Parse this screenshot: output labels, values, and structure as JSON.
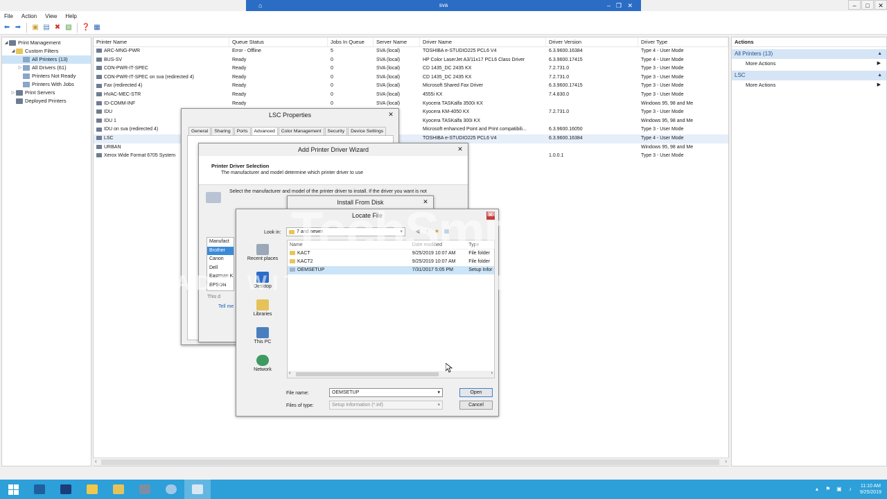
{
  "window": {
    "title": "sva",
    "controls": [
      "–",
      "□",
      "✕"
    ]
  },
  "menu": [
    "File",
    "Action",
    "View",
    "Help"
  ],
  "tree": [
    {
      "label": "Print Management",
      "level": 0,
      "expander": "◢"
    },
    {
      "label": "Custom Filters",
      "level": 1,
      "expander": "◢"
    },
    {
      "label": "All Printers (13)",
      "level": 2,
      "expander": "",
      "selected": true
    },
    {
      "label": "All Drivers (61)",
      "level": 2,
      "expander": "▷"
    },
    {
      "label": "Printers Not Ready",
      "level": 2,
      "expander": ""
    },
    {
      "label": "Printers With Jobs",
      "level": 2,
      "expander": ""
    },
    {
      "label": "Print Servers",
      "level": 1,
      "expander": "▷"
    },
    {
      "label": "Deployed Printers",
      "level": 1,
      "expander": ""
    }
  ],
  "list": {
    "columns": [
      "Printer Name",
      "Queue Status",
      "Jobs In Queue",
      "Server Name",
      "Driver Name",
      "Driver Version",
      "Driver Type"
    ],
    "rows": [
      [
        "ARC-MNG-PWR",
        "Error - Offline",
        "5",
        "SVA (local)",
        "TOSHIBA e-STUDIO225 PCL6 V4",
        "6.3.9600.16384",
        "Type 4 - User Mode"
      ],
      [
        "BUS-SV",
        "Ready",
        "0",
        "SVA (local)",
        "HP Color LaserJet A3/11x17 PCL6 Class Driver",
        "6.3.9600.17415",
        "Type 4 - User Mode"
      ],
      [
        "CON-PWR-IT-SPEC",
        "Ready",
        "0",
        "SVA (local)",
        "CD 1435_DC 2435 KX",
        "7.2.731.0",
        "Type 3 - User Mode"
      ],
      [
        "CON-PWR-IT-SPEC on sva (redirected 4)",
        "Ready",
        "0",
        "SVA (local)",
        "CD 1435_DC 2435 KX",
        "7.2.731.0",
        "Type 3 - User Mode"
      ],
      [
        "Fax (redirected 4)",
        "Ready",
        "0",
        "SVA (local)",
        "Microsoft Shared Fax Driver",
        "6.3.9600.17415",
        "Type 3 - User Mode"
      ],
      [
        "HVAC-MEC-STR",
        "Ready",
        "0",
        "SVA (local)",
        "4555i KX",
        "7.4.830.0",
        "Type 3 - User Mode"
      ],
      [
        "ID-COMM-INF",
        "Ready",
        "0",
        "SVA (local)",
        "Kyocera TASKalfa 3500i KX",
        "",
        "Windows 95, 98 and Me"
      ],
      [
        "IDU",
        "",
        "",
        "",
        "Kyocera KM-4050 KX",
        "7.2.731.0",
        "Type 3 - User Mode"
      ],
      [
        "IDU 1",
        "",
        "",
        "",
        "Kyocera TASKalfa 300i KX",
        "",
        "Windows 95, 98 and Me"
      ],
      [
        "IDU on sva (redirected 4)",
        "",
        "",
        "",
        "Microsoft enhanced Point and Print compatibili...",
        "6.3.9600.16050",
        "Type 3 - User Mode"
      ],
      [
        "LSC",
        "",
        "",
        "",
        "TOSHIBA e-STUDIO225 PCL6 V4",
        "6.3.9600.16384",
        "Type 4 - User Mode"
      ],
      [
        "URBAN",
        "",
        "",
        "",
        "300i KX",
        "",
        "Windows 95, 98 and Me"
      ],
      [
        "Xerox Wide Format 6705 System",
        "",
        "",
        "",
        "6705 System",
        "1.0.0.1",
        "Type 3 - User Mode"
      ]
    ],
    "selected_row": 10
  },
  "actions": {
    "header": "Actions",
    "groups": [
      {
        "title": "All Printers (13)",
        "items": [
          "More Actions"
        ]
      },
      {
        "title": "LSC",
        "items": [
          "More Actions"
        ]
      }
    ]
  },
  "lsc_dialog": {
    "title": "LSC Properties",
    "tabs": [
      "General",
      "Sharing",
      "Ports",
      "Advanced",
      "Color Management",
      "Security",
      "Device Settings"
    ],
    "active_tab": "Advanced"
  },
  "wizard": {
    "title": "Add Printer Driver Wizard",
    "heading": "Printer Driver Selection",
    "subheading": "The manufacturer and model determine which printer driver to use",
    "description": "Select the manufacturer and model of the printer driver to install. If the driver you want is not",
    "manufacturer_header": "Manufact",
    "manufacturers": [
      "Brother",
      "Canon",
      "Dell",
      "Eastman K",
      "EPSON"
    ],
    "selected_manufacturer": "Brother",
    "signed_note": "This d",
    "tell_me": "Tell me"
  },
  "install_dialog": {
    "title": "Install From Disk"
  },
  "locate_dialog": {
    "title": "Locate File",
    "look_in_label": "Look in:",
    "look_in_value": "7 and newer",
    "places": [
      "Recent places",
      "Desktop",
      "Libraries",
      "This PC",
      "Network"
    ],
    "columns": [
      "Name",
      "Date modified",
      "Type"
    ],
    "files": [
      {
        "name": "KACT",
        "date": "9/25/2019 10:07 AM",
        "type": "File folder"
      },
      {
        "name": "KACT2",
        "date": "9/25/2019 10:07 AM",
        "type": "File folder"
      },
      {
        "name": "OEMSETUP",
        "date": "7/31/2017 5:05 PM",
        "type": "Setup Infor",
        "selected": true
      }
    ],
    "file_name_label": "File name:",
    "file_name_value": "OEMSETUP",
    "files_of_type_label": "Files of type:",
    "files_of_type_value": "Setup Information (*.inf)",
    "open_label": "Open",
    "cancel_label": "Cancel"
  },
  "watermark": {
    "brand": "TechSmith",
    "text": "MADE WITH CAMTASIA FREE TRIAL"
  },
  "taskbar": {
    "clock_time": "11:10 AM",
    "clock_date": "9/25/2019"
  },
  "colors": {
    "taskbar": "#2d9fd9",
    "titlebar_active": "#2b6cc4",
    "selection": "#cce4f7",
    "action_group": "#d6e5f5"
  }
}
